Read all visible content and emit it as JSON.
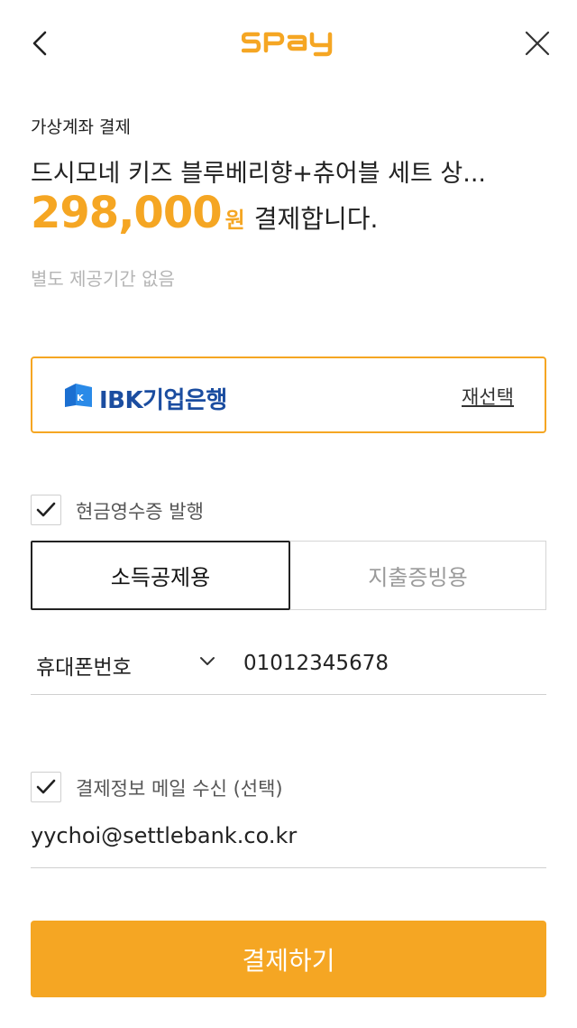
{
  "header": {
    "logo_text": "SPay",
    "back_icon": "chevron-left-icon",
    "close_icon": "close-icon",
    "brand_color": "#f5a623"
  },
  "payment": {
    "method_label": "가상계좌 결제",
    "product_name": "드시모네 키즈 블루베리향+츄어블 세트 상...",
    "amount": "298,000",
    "currency": "원",
    "action_text": "결제합니다.",
    "notice": "별도 제공기간 없음"
  },
  "bank": {
    "name": "IBK기업은행",
    "logo_text": "IBK",
    "reselect_label": "재선택"
  },
  "cash_receipt": {
    "checked": true,
    "label": "현금영수증 발행",
    "options": [
      "소득공제용",
      "지출증빙용"
    ],
    "selected": "소득공제용",
    "id_type": "휴대폰번호",
    "id_value": "01012345678"
  },
  "email": {
    "checked": true,
    "label": "결제정보 메일 수신 (선택)",
    "value": "yychoi@settlebank.co.kr"
  },
  "submit": {
    "label": "결제하기"
  }
}
